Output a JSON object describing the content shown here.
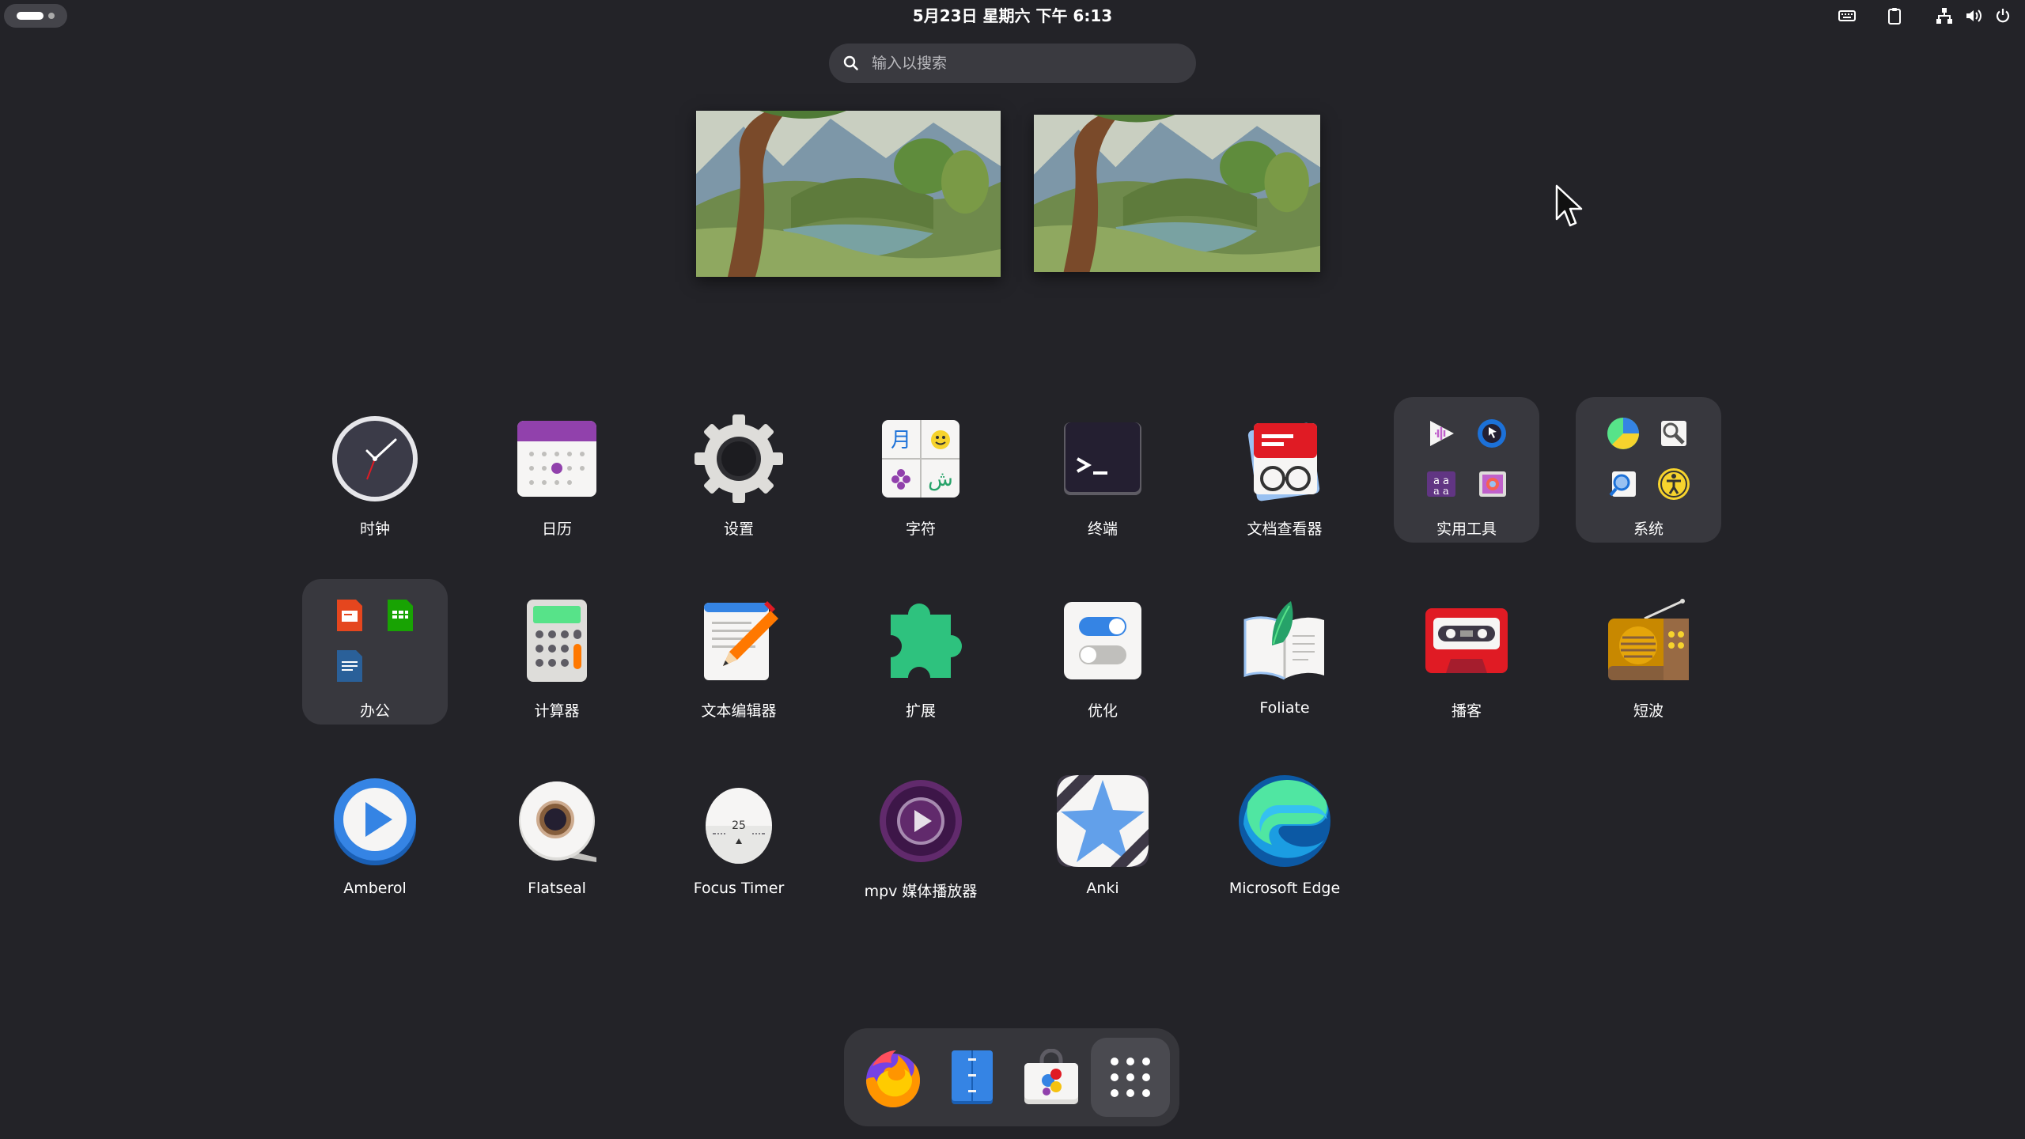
{
  "topbar": {
    "clock": "5月23日 星期六  下午 6:13"
  },
  "search": {
    "placeholder": "输入以搜索"
  },
  "apps": [
    {
      "label": "时钟",
      "icon": "clock-icon"
    },
    {
      "label": "日历",
      "icon": "calendar-icon"
    },
    {
      "label": "设置",
      "icon": "settings-gear-icon"
    },
    {
      "label": "字符",
      "icon": "characters-icon"
    },
    {
      "label": "终端",
      "icon": "terminal-icon"
    },
    {
      "label": "文档查看器",
      "icon": "document-viewer-icon"
    },
    {
      "label": "实用工具",
      "icon": "utilities-folder-icon"
    },
    {
      "label": "系统",
      "icon": "system-folder-icon"
    },
    {
      "label": "办公",
      "icon": "office-folder-icon"
    },
    {
      "label": "计算器",
      "icon": "calculator-icon"
    },
    {
      "label": "文本编辑器",
      "icon": "text-editor-icon"
    },
    {
      "label": "扩展",
      "icon": "extensions-puzzle-icon"
    },
    {
      "label": "优化",
      "icon": "tweaks-toggle-icon"
    },
    {
      "label": "Foliate",
      "icon": "foliate-book-icon"
    },
    {
      "label": "播客",
      "icon": "podcasts-cassette-icon"
    },
    {
      "label": "短波",
      "icon": "shortwave-radio-icon"
    },
    {
      "label": "Amberol",
      "icon": "amberol-play-icon"
    },
    {
      "label": "Flatseal",
      "icon": "flatseal-tape-icon"
    },
    {
      "label": "Focus Timer",
      "icon": "focus-timer-egg-icon"
    },
    {
      "label": "mpv 媒体播放器",
      "icon": "mpv-player-icon"
    },
    {
      "label": "Anki",
      "icon": "anki-star-icon"
    },
    {
      "label": "Microsoft Edge",
      "icon": "edge-browser-icon"
    }
  ],
  "focus_timer_number": "25",
  "dock": [
    {
      "icon": "firefox-icon"
    },
    {
      "icon": "files-icon"
    },
    {
      "icon": "software-store-icon"
    },
    {
      "icon": "show-apps-grid-icon"
    }
  ],
  "colors": {
    "background": "#232328",
    "folder_bg": "#38383e",
    "dock_bg": "#36363b"
  }
}
